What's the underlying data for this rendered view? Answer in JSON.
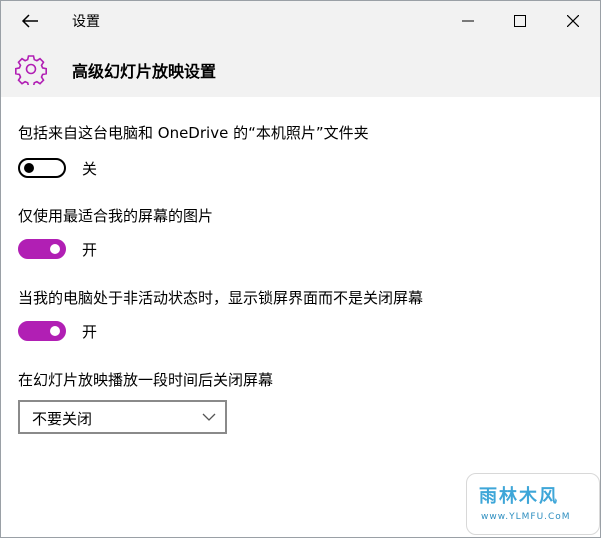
{
  "window": {
    "title": "设置",
    "controls": [
      "back-icon",
      "minimize-icon",
      "maximize-icon",
      "close-icon"
    ]
  },
  "header": {
    "icon": "gear-icon",
    "title": "高级幻灯片放映设置"
  },
  "settings": [
    {
      "label": "包括来自这台电脑和 OneDrive 的“本机照片”文件夹",
      "on": false,
      "state": "关"
    },
    {
      "label": "仅使用最适合我的屏幕的图片",
      "on": true,
      "state": "开"
    },
    {
      "label": "当我的电脑处于非活动状态时，显示锁屏界面而不是关闭屏幕",
      "on": true,
      "state": "开"
    }
  ],
  "turn_off": {
    "label": "在幻灯片放映播放一段时间后关闭屏幕",
    "selected": "不要关闭"
  },
  "colors": {
    "accent": "#b11fb4",
    "titlebar_bg": "#f2f2f2"
  },
  "watermark": {
    "logo": "雨林木风",
    "url": "www.YLMFU.CoM"
  }
}
